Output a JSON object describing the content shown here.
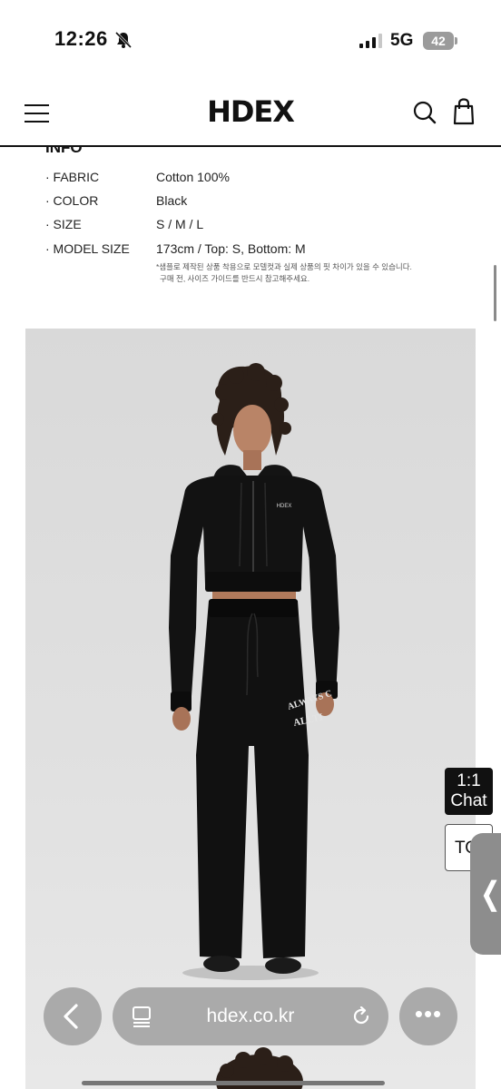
{
  "status_bar": {
    "time": "12:26",
    "network": "5G",
    "battery": "42",
    "silent_icon": "bell-slash-icon",
    "signal_bars_active": 3
  },
  "header": {
    "logo": "HDEX",
    "menu_icon": "hamburger-menu-icon",
    "search_icon": "search-icon",
    "cart_icon": "shopping-bag-icon"
  },
  "info": {
    "title": "INFO",
    "rows": [
      {
        "key": "· FABRIC",
        "value": "Cotton 100%"
      },
      {
        "key": "· COLOR",
        "value": "Black"
      },
      {
        "key": "· SIZE",
        "value": "S / M / L"
      },
      {
        "key": "· MODEL SIZE",
        "value": "173cm / Top: S, Bottom: M"
      }
    ],
    "note_line1": "*샘플로 제작된 상품 착용으로 모델컷과 실제 상품의 핏 차이가 있을 수 있습니다.",
    "note_line2": "구매 전, 사이즈 가이드를 반드시 참고해주세요."
  },
  "product_photo": {
    "zip_logo": "HDEX",
    "pants_print_1": "ALWAYS C",
    "pants_print_2": "ALLTI"
  },
  "floating": {
    "chat_line1": "1:1",
    "chat_line2": "Chat",
    "top_label": "TO",
    "side_tab_glyph": "❬"
  },
  "browser": {
    "url": "hdex.co.kr",
    "back_icon": "chevron-left-icon",
    "tabs_icon": "tab-overview-icon",
    "reload_icon": "reload-icon",
    "more_label": "•••"
  },
  "colors": {
    "text": "#111111",
    "photo_bg": "#dcdcdc",
    "garment": "#111111"
  }
}
